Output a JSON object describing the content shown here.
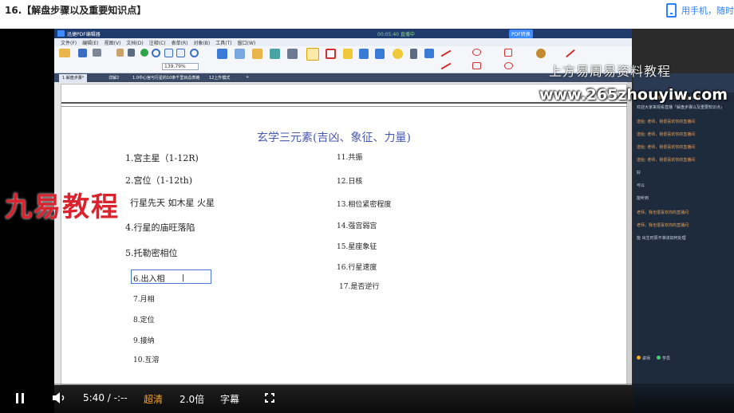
{
  "page": {
    "lesson_title": "16.【解盘步骤以及重要知识点】",
    "phone_link": "用手机，随时"
  },
  "app": {
    "title": "迅捷PDF编辑器",
    "recording": "00:05:40 直播中",
    "convert_btn": "PDF转换",
    "menu": [
      "文件(F)",
      "编辑(E)",
      "视图(V)",
      "文档(D)",
      "注释(C)",
      "表单(R)",
      "对象(B)",
      "工具(T)",
      "窗口(W)"
    ],
    "zoom": "139.79%",
    "tabs": [
      "1.解盘步骤*",
      "详解2",
      "1.0中心宫与行星的10条千里目总表格",
      "12上升模式"
    ]
  },
  "doc": {
    "title": "玄学三元素(吉凶、象征、力量)",
    "left_items": [
      "1.宫主星（1-12R)",
      "2.宫位（1-12th)",
      "行星先天 如木星 火星",
      "4.行星的庙旺落陷",
      "5.托勒密相位",
      "6.出入相",
      "7.月相",
      "8.定位",
      "9.接纳",
      "10.互溶"
    ],
    "right_items": [
      "11.共振",
      "12.日核",
      "13.相位紧密程度",
      "14.强宫弱宫",
      "15.星座象征",
      "16.行星速度",
      "17.是否逆行"
    ]
  },
  "chat": {
    "messages": [
      {
        "name": "",
        "text": "欢迎进入直播间：第三期占星小课堂"
      },
      {
        "name": "",
        "text": "欢迎大家来观看直播『解盘步骤以及重要知识点』"
      },
      {
        "name": "",
        "text": "送给: 老师，我很喜欢你的直播间"
      },
      {
        "name": "",
        "text": "送给: 老师，我很喜欢你的直播间"
      },
      {
        "name": "",
        "text": "送给: 老师，我很喜欢你的直播间"
      },
      {
        "name": "",
        "text": "送给: 老师，我很喜欢你的直播间"
      },
      {
        "name": "",
        "text": "好"
      },
      {
        "name": "",
        "text": "可以"
      },
      {
        "name": "",
        "text": "能听到"
      },
      {
        "name": "",
        "text": "老师，我也很喜欢你的直播间"
      },
      {
        "name": "",
        "text": "老师，我也很喜欢你的直播间"
      },
      {
        "name": "",
        "text": "能 出生时辰不准该如何处理"
      }
    ],
    "legend_a": "讲师",
    "legend_b": "学员"
  },
  "watermarks": {
    "site_cn": "上方易周易资料教程",
    "site_url": "www.265zhouyiw.com",
    "brand": "九易教程"
  },
  "player": {
    "time": "5:40 / -:--",
    "quality": "超清",
    "speed": "2.0倍",
    "subtitle": "字幕",
    "quality_color": "#f5a623"
  }
}
